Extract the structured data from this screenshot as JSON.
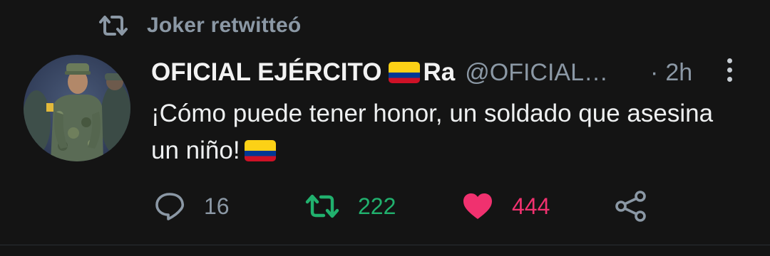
{
  "retweet_context": {
    "icon": "retweet-icon",
    "text": "Joker retwitteó"
  },
  "tweet": {
    "avatar": "profile-photo-soldier",
    "display_name": "OFICIAL EJÉRCITO",
    "name_flag": "colombia-flag",
    "name_suffix": "Ra",
    "handle": "@OFICIAL…",
    "time_separator": "·",
    "time": "2h",
    "text": "¡Cómo puede tener honor, un soldado que asesina un niño!",
    "text_flag": "colombia-flag"
  },
  "actions": {
    "reply": {
      "icon": "reply-icon",
      "count": "16"
    },
    "retweet": {
      "icon": "retweet-icon",
      "count": "222",
      "active": true
    },
    "like": {
      "icon": "heart-icon",
      "count": "444",
      "active": true
    },
    "share": {
      "icon": "share-icon"
    }
  },
  "colors": {
    "background": "#141414",
    "muted": "#8b98a5",
    "retweet_green": "#21b16e",
    "like_pink": "#f0316f",
    "flag_yellow": "#fcd116",
    "flag_blue": "#003893",
    "flag_red": "#ce1126"
  }
}
